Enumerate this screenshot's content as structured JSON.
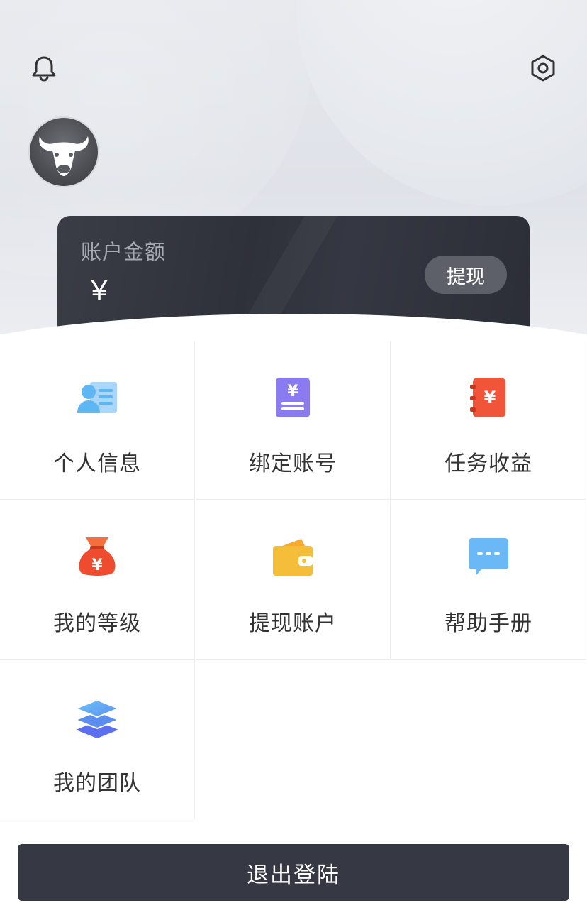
{
  "header": {
    "notification_icon": "bell-icon",
    "settings_icon": "settings-hexagon-icon",
    "avatar_icon": "bull-head-avatar"
  },
  "balance": {
    "label": "账户金额",
    "currency_symbol": "￥",
    "withdraw_label": "提现"
  },
  "menu": {
    "items": [
      {
        "label": "个人信息",
        "icon": "id-card-icon",
        "color": "#5eb6f5"
      },
      {
        "label": "绑定账号",
        "icon": "bill-yuan-icon",
        "color": "#8a7bf0"
      },
      {
        "label": "任务收益",
        "icon": "red-packet-yuan-icon",
        "color": "#f0553a"
      },
      {
        "label": "我的等级",
        "icon": "money-bag-icon",
        "color": "#ef4b2f"
      },
      {
        "label": "提现账户",
        "icon": "wallet-icon",
        "color": "#f5be3a"
      },
      {
        "label": "帮助手册",
        "icon": "chat-bubble-icon",
        "color": "#6ab8f5"
      },
      {
        "label": "我的团队",
        "icon": "layers-icon",
        "color": "#5b8ef0"
      }
    ]
  },
  "logout_label": "退出登陆",
  "colors": {
    "card_bg": "#30333c",
    "logout_bg": "#363944",
    "withdraw_bg": "#5d6068"
  }
}
